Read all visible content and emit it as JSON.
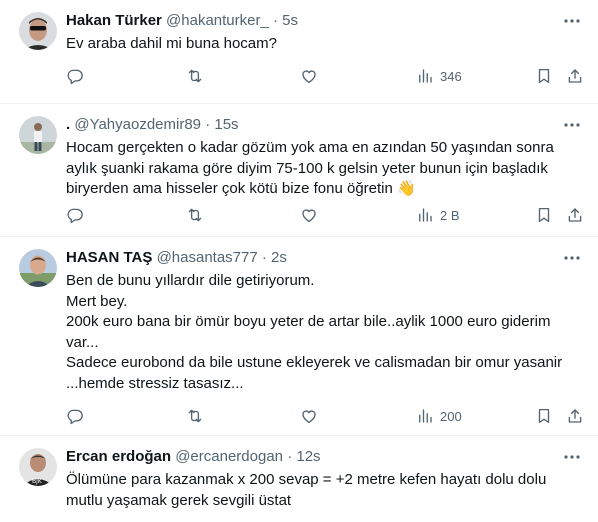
{
  "tweets": [
    {
      "name": "Hakan Türker",
      "handle": "@hakanturker_",
      "dot": "·",
      "time": "5s",
      "lines": [
        "Ev araba dahil mi buna hocam?"
      ],
      "views": "346"
    },
    {
      "name": ".",
      "handle": "@Yahyaozdemir89",
      "dot": "·",
      "time": "15s",
      "lines": [
        "Hocam gerçekten o kadar gözüm yok ama en azından 50 yaşından sonra",
        "aylık şuanki rakama göre diyim 75-100 k gelsin yeter bunun için başladık",
        "biryerden ama hisseler çok kötü bize fonu öğretin 👋"
      ],
      "views": "2 B"
    },
    {
      "name": "HASAN TAŞ",
      "handle": "@hasantas777",
      "dot": "·",
      "time": "2s",
      "lines": [
        "Ben de bunu yıllardır dile getiriyorum.",
        "Mert bey.",
        "200k euro bana bir ömür boyu yeter de artar bile..aylik 1000 euro giderim",
        "var...",
        "Sadece eurobond da bile ustune ekleyerek ve calismadan bir omur yasanir",
        "...hemde stressiz tasasız..."
      ],
      "views": "200"
    },
    {
      "name": "Ercan erdoğan",
      "handle": "@ercanerdogan",
      "dot": "·",
      "time": "12s",
      "lines": [
        "Ölümüne para kazanmak x 200 sevap = +2 metre kefen hayatı dolu dolu",
        "mutlu yaşamak gerek sevgili üstat"
      ],
      "views": ""
    }
  ],
  "colors": {
    "text": "#0f1419",
    "secondary": "#536471",
    "divider": "#eff3f4"
  },
  "icons": [
    "reply-icon",
    "retweet-icon",
    "like-icon",
    "views-icon",
    "bookmark-icon",
    "share-icon",
    "more-icon"
  ]
}
